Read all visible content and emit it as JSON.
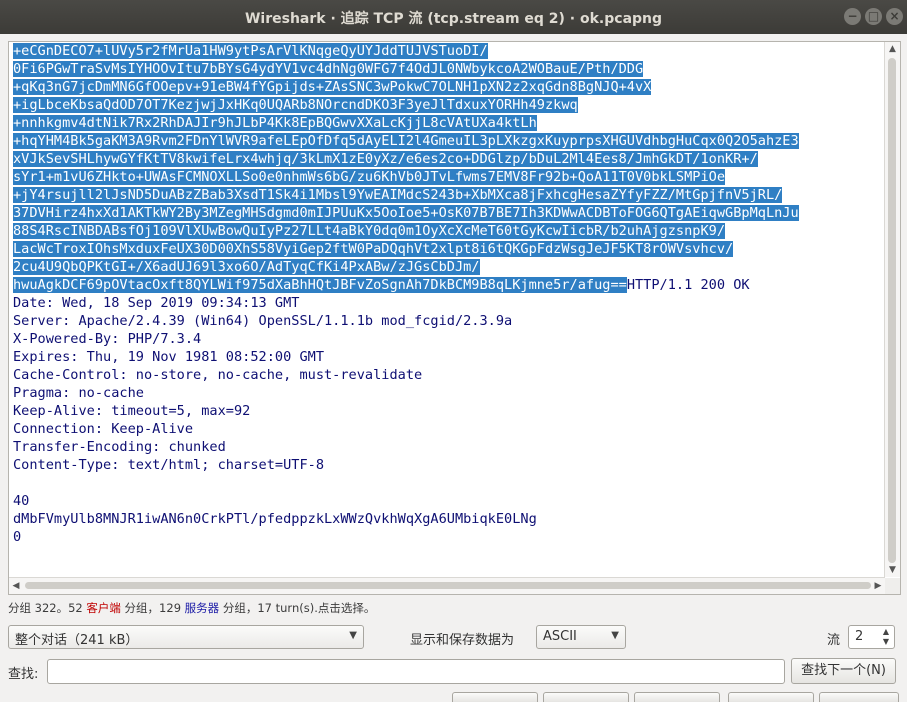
{
  "window": {
    "title": "Wireshark · 追踪 TCP 流 (tcp.stream eq 2) · ok.pcapng",
    "minimize_glyph": "−",
    "maximize_glyph": "□",
    "close_glyph": "×"
  },
  "stream": {
    "client_lines": [
      "+eCGnDECO7+lUVy5r2fMrUa1HW9ytPsArVlKNqgeQyUYJddTUJVSTuoDI/",
      "0Fi6PGwTraSvMsIYHOOvItu7bBYsG4ydYV1vc4dhNg0WFG7f4OdJL0NWbykcoA2WOBauE/Pth/DDG",
      "+qKq3nG7jcDmMN6GfOOepv+91eBW4fYGpijds+ZAsSNC3wPokwC7OLNH1pXN2z2xqGdn8BgNJQ+4vX",
      "+igLbceKbsaQdOD7OT7KezjwjJxHKq0UQARb8NOrcndDKO3F3yeJlTdxuxYORHh49zkwq",
      "+nnhkgmv4dtNik7Rx2RhDAJIr9hJLbP4Kk8EpBQGwvXXaLcKjjL8cVAtUXa4ktLh",
      "+hqYHM4Bk5gaKM3A9Rvm2FDnYlWVR9afeLEpOfDfq5dAyELI2l4GmeuIL3pLXkzgxKuyprpsXHGUVdhbgHuCqx0Q2O5ahzE3",
      "xVJkSevSHLhywGYfKtTV8kwifeLrx4whjq/3kLmX1zE0yXz/e6es2co+DDGlzp/bDuL2Ml4Ees8/JmhGkDT/1onKR+/",
      "sYr1+m1vU6ZHkto+UWAsFCMNOXLLSo0e0nhmWs6bG/zu6KhVb0JTvLfwms7EMV8Fr92b+QoA11T0V0bkLSMPiOe",
      "+jY4rsujll2lJsND5DuABzZBab3XsdT1Sk4i1Mbsl9YwEAIMdcS243b+XbMXca8jFxhcgHesaZYfyFZZ/MtGpjfnV5jRL/",
      "37DVHirz4hxXd1AKTkWY2By3MZegMHSdgmd0mIJPUuKx5OoIoe5+OsK07B7BE7Ih3KDWwACDBToFOG6QTgAEiqwGBpMqLnJu",
      "88S4RscINBDABsfOj109VlXUwBowQuIyPz27LLt4aBkY0dq0m1OyXcXcMeT60tGyKcwIicbR/b2uhAjgzsnpK9/",
      "LacWcTroxIOhsMxduxFeUX30D00XhS58VyiGep2ftW0PaDQqhVt2xlpt8i6tQKGpFdzWsgJeJF5KT8rOWVsvhcv/",
      "2cu4U9QbQPKtGI+/X6adUJ69l3xo6O/AdTyqCfKi4PxABw/zJGsCbDJm/",
      "hwuAgkDCF69pOVtacOxft8QYLWif975dXaBhHQtJBFvZoSgnAh7DkBCM9B8qLKjmne5r/afug=="
    ],
    "server_first_tail": "HTTP/1.1 200 OK",
    "server_lines": [
      "Date: Wed, 18 Sep 2019 09:34:13 GMT",
      "Server: Apache/2.4.39 (Win64) OpenSSL/1.1.1b mod_fcgid/2.3.9a",
      "X-Powered-By: PHP/7.3.4",
      "Expires: Thu, 19 Nov 1981 08:52:00 GMT",
      "Cache-Control: no-store, no-cache, must-revalidate",
      "Pragma: no-cache",
      "Keep-Alive: timeout=5, max=92",
      "Connection: Keep-Alive",
      "Transfer-Encoding: chunked",
      "Content-Type: text/html; charset=UTF-8",
      "",
      "40",
      "dMbFVmyUlb8MNJR1iwAN6n0CrkPTl/pfedppzkLxWWzQvkhWqXgA6UMbiqkE0LNg",
      "0"
    ]
  },
  "status": {
    "part1": "分组 322。52 ",
    "client_word": "客户端",
    "part2": " 分组，129 ",
    "server_word": "服务器",
    "part3": " 分组，17 turn(s).点击选择。"
  },
  "controls": {
    "conversation_select": "整个对话（241 kB）",
    "show_save_label": "显示和保存数据为",
    "format_select": "ASCII",
    "stream_label": "流",
    "stream_value": "2",
    "find_label": "查找:",
    "find_value": "",
    "find_next_button": "查找下一个(N)"
  },
  "colors": {
    "client_highlight": "#2f7fc4",
    "server_text": "#0e0f73"
  }
}
